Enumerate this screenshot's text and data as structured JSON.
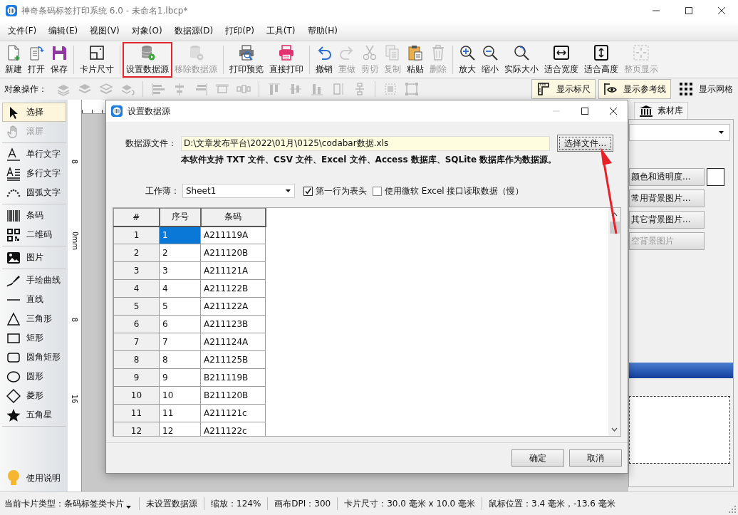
{
  "window": {
    "title": "神奇条码标签打印系统 6.0 - 未命名1.lbcp*"
  },
  "menu": [
    "文件(F)",
    "编辑(E)",
    "视图(V)",
    "对象(O)",
    "数据源(D)",
    "打印(P)",
    "工具(T)",
    "帮助(H)"
  ],
  "toolbar": {
    "groups": [
      [
        {
          "label": "新建",
          "disabled": false,
          "highlighted": false
        },
        {
          "label": "打开",
          "disabled": false,
          "highlighted": false
        },
        {
          "label": "保存",
          "disabled": false,
          "highlighted": false
        }
      ],
      [
        {
          "label": "卡片尺寸",
          "disabled": false,
          "highlighted": false
        }
      ],
      [
        {
          "label": "设置数据源",
          "disabled": false,
          "highlighted": true
        },
        {
          "label": "移除数据源",
          "disabled": true,
          "highlighted": false
        }
      ],
      [
        {
          "label": "打印预览",
          "disabled": false,
          "highlighted": false
        },
        {
          "label": "直接打印",
          "disabled": false,
          "highlighted": false
        }
      ],
      [
        {
          "label": "撤销",
          "disabled": false,
          "highlighted": false
        },
        {
          "label": "重做",
          "disabled": true,
          "highlighted": false
        },
        {
          "label": "剪切",
          "disabled": true,
          "highlighted": false
        },
        {
          "label": "复制",
          "disabled": true,
          "highlighted": false
        },
        {
          "label": "粘贴",
          "disabled": false,
          "highlighted": false
        },
        {
          "label": "删除",
          "disabled": true,
          "highlighted": false
        }
      ],
      [
        {
          "label": "放大",
          "disabled": false,
          "highlighted": false
        },
        {
          "label": "缩小",
          "disabled": false,
          "highlighted": false
        },
        {
          "label": "实际大小",
          "disabled": false,
          "highlighted": false
        },
        {
          "label": "适合宽度",
          "disabled": false,
          "highlighted": false
        },
        {
          "label": "适合高度",
          "disabled": false,
          "highlighted": false
        },
        {
          "label": "整页显示",
          "disabled": true,
          "highlighted": false
        }
      ]
    ]
  },
  "object_toolbar": {
    "label": "对象操作：",
    "toggles": [
      {
        "label": "显示标尺",
        "on": true
      },
      {
        "label": "显示参考线",
        "on": true
      },
      {
        "label": "显示网格",
        "on": false
      }
    ]
  },
  "tools": {
    "groups": [
      [
        {
          "label": "选择",
          "selected": true,
          "disabled": false
        },
        {
          "label": "滚屏",
          "selected": false,
          "disabled": true
        }
      ],
      [
        {
          "label": "单行文字",
          "selected": false,
          "disabled": false
        },
        {
          "label": "多行文字",
          "selected": false,
          "disabled": false
        },
        {
          "label": "圆弧文字",
          "selected": false,
          "disabled": false
        }
      ],
      [
        {
          "label": "条码",
          "selected": false,
          "disabled": false
        },
        {
          "label": "二维码",
          "selected": false,
          "disabled": false
        }
      ],
      [
        {
          "label": "图片",
          "selected": false,
          "disabled": false
        }
      ],
      [
        {
          "label": "手绘曲线",
          "selected": false,
          "disabled": false
        },
        {
          "label": "直线",
          "selected": false,
          "disabled": false
        },
        {
          "label": "三角形",
          "selected": false,
          "disabled": false
        },
        {
          "label": "矩形",
          "selected": false,
          "disabled": false
        },
        {
          "label": "圆角矩形",
          "selected": false,
          "disabled": false
        },
        {
          "label": "圆形",
          "selected": false,
          "disabled": false
        },
        {
          "label": "菱形",
          "selected": false,
          "disabled": false
        },
        {
          "label": "五角星",
          "selected": false,
          "disabled": false
        }
      ]
    ],
    "help": "使用说明"
  },
  "ruler": {
    "vertical_labels": [
      "8",
      "0mm",
      "8",
      "16"
    ]
  },
  "right_panel": {
    "tab": "素材库",
    "buttons": [
      {
        "label": "颜色和透明度...",
        "disabled": false
      },
      {
        "label": "常用背景图片...",
        "disabled": false
      },
      {
        "label": "其它背景图片...",
        "disabled": false
      },
      {
        "label": "空背景图片",
        "disabled": true
      }
    ]
  },
  "dialog": {
    "title": "设置数据源",
    "file_label": "数据源文件：",
    "file_path": "D:\\文章发布平台\\2022\\01月\\0125\\codabar数据.xls",
    "browse_button": "选择文件...",
    "note": "本软件支持 TXT 文件、CSV 文件、Excel 文件、Access 数据库、SQLite 数据库作为数据源。",
    "sheet_label": "工作薄：",
    "sheet_value": "Sheet1",
    "checkboxes": [
      {
        "label": "第一行为表头",
        "checked": true
      },
      {
        "label": "使用微软 Excel 接口读取数据（慢）",
        "checked": false
      }
    ],
    "grid": {
      "columns": [
        "#",
        "序号",
        "条码"
      ],
      "rows": [
        {
          "cells": [
            {
              "text": "1",
              "selected": false
            },
            {
              "text": "1",
              "selected": true
            },
            {
              "text": "A211119A",
              "selected": false
            }
          ]
        },
        {
          "cells": [
            {
              "text": "2",
              "selected": false
            },
            {
              "text": "2",
              "selected": false
            },
            {
              "text": "A211120B",
              "selected": false
            }
          ]
        },
        {
          "cells": [
            {
              "text": "3",
              "selected": false
            },
            {
              "text": "3",
              "selected": false
            },
            {
              "text": "A211121A",
              "selected": false
            }
          ]
        },
        {
          "cells": [
            {
              "text": "4",
              "selected": false
            },
            {
              "text": "4",
              "selected": false
            },
            {
              "text": "A211122B",
              "selected": false
            }
          ]
        },
        {
          "cells": [
            {
              "text": "5",
              "selected": false
            },
            {
              "text": "5",
              "selected": false
            },
            {
              "text": "A211122A",
              "selected": false
            }
          ]
        },
        {
          "cells": [
            {
              "text": "6",
              "selected": false
            },
            {
              "text": "6",
              "selected": false
            },
            {
              "text": "A211123B",
              "selected": false
            }
          ]
        },
        {
          "cells": [
            {
              "text": "7",
              "selected": false
            },
            {
              "text": "7",
              "selected": false
            },
            {
              "text": "A211124A",
              "selected": false
            }
          ]
        },
        {
          "cells": [
            {
              "text": "8",
              "selected": false
            },
            {
              "text": "8",
              "selected": false
            },
            {
              "text": "A211125B",
              "selected": false
            }
          ]
        },
        {
          "cells": [
            {
              "text": "9",
              "selected": false
            },
            {
              "text": "9",
              "selected": false
            },
            {
              "text": "B211119B",
              "selected": false
            }
          ]
        },
        {
          "cells": [
            {
              "text": "10",
              "selected": false
            },
            {
              "text": "10",
              "selected": false
            },
            {
              "text": "B211120B",
              "selected": false
            }
          ]
        },
        {
          "cells": [
            {
              "text": "11",
              "selected": false
            },
            {
              "text": "11",
              "selected": false
            },
            {
              "text": "A211121c",
              "selected": false
            }
          ]
        },
        {
          "cells": [
            {
              "text": "12",
              "selected": false
            },
            {
              "text": "12",
              "selected": false
            },
            {
              "text": "A211122c",
              "selected": false
            }
          ]
        }
      ]
    },
    "buttons": [
      "确定",
      "取消"
    ]
  },
  "status_bar": [
    {
      "text": "当前卡片类型：条码标签类卡片",
      "kind": "dropdown"
    },
    {
      "text": "未设置数据源",
      "kind": "text"
    },
    {
      "text": "缩放：124%",
      "kind": "text"
    },
    {
      "text": "画布DPI：300",
      "kind": "text"
    },
    {
      "text": "卡片尺寸：30.0 毫米 x 10.0 毫米",
      "kind": "text"
    },
    {
      "text": "鼠标位置：3.4 毫米，-13.6 毫米",
      "kind": "text"
    }
  ]
}
